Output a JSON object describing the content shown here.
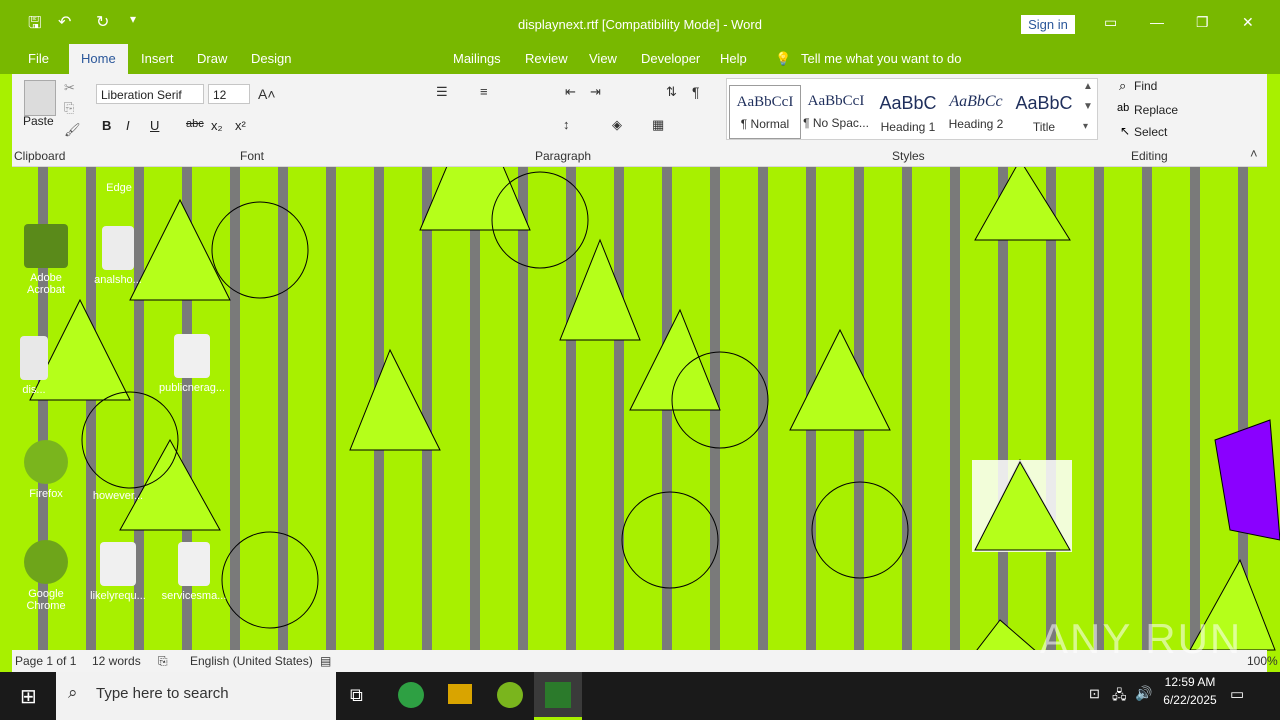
{
  "window": {
    "title": "displaynext.rtf [Compatibility Mode]  -  Word",
    "sign_in": "Sign in",
    "minimize": "—",
    "restore": "❐",
    "close": "✕"
  },
  "tabs": {
    "file": "File",
    "home": "Home",
    "insert": "Insert",
    "draw": "Draw",
    "design": "Design",
    "mailings": "Mailings",
    "review": "Review",
    "view": "View",
    "developer": "Developer",
    "help": "Help",
    "tell_me": "Tell me what you want to do"
  },
  "ribbon": {
    "clipboard": {
      "paste": "Paste",
      "label": "Clipboard"
    },
    "font": {
      "family": "Liberation Serif",
      "size": "12",
      "label": "Font",
      "bold": "B",
      "italic": "I",
      "underline": "U",
      "strike": "abc",
      "subscript": "x₂",
      "superscript": "x²"
    },
    "paragraph": {
      "label": "Paragraph"
    },
    "styles": {
      "label": "Styles",
      "items": [
        {
          "sample": "AaBbCcI",
          "name": "¶ Normal"
        },
        {
          "sample": "AaBbCcI",
          "name": "¶ No Spac..."
        },
        {
          "sample": "AaBbC",
          "name": "Heading 1"
        },
        {
          "sample": "AaBbCc",
          "name": "Heading 2"
        },
        {
          "sample": "AaBbC",
          "name": "Title"
        }
      ]
    },
    "editing": {
      "label": "Editing",
      "find": "Find",
      "replace": "Replace",
      "select": "Select"
    }
  },
  "desktop": {
    "icons": [
      {
        "label": "Edge"
      },
      {
        "label": "Adobe Acrobat"
      },
      {
        "label": "analsho..."
      },
      {
        "label": "dis..."
      },
      {
        "label": "publicnerag..."
      },
      {
        "label": "Firefox"
      },
      {
        "label": "however..."
      },
      {
        "label": "Google Chrome"
      },
      {
        "label": "likelyrequ..."
      },
      {
        "label": "servicesma..."
      }
    ]
  },
  "statusbar": {
    "page": "Page 1 of 1",
    "words": "12 words",
    "language": "English (United States)",
    "zoom": "100%"
  },
  "taskbar": {
    "search_placeholder": "Type here to search",
    "time": "12:59 AM",
    "date": "6/22/2025"
  },
  "watermark": "ANY RUN",
  "colors": {
    "accent": "#78b800",
    "stripe": "#a8f000",
    "word_blue": "#2b579a"
  }
}
